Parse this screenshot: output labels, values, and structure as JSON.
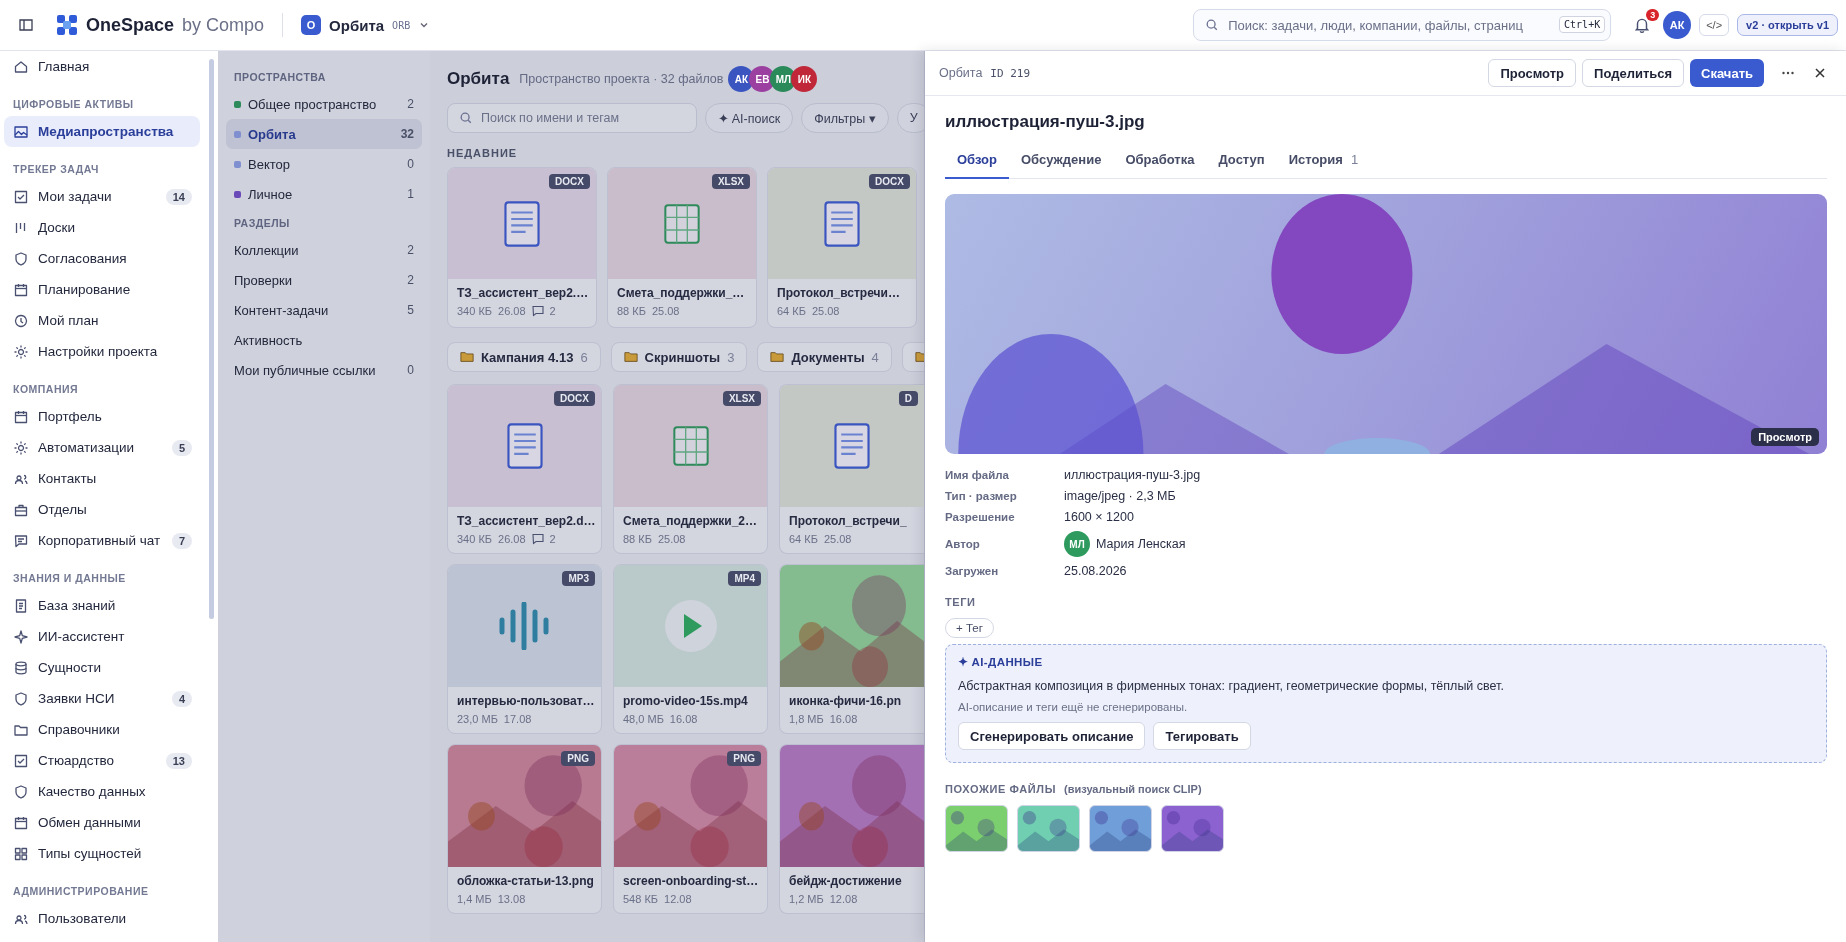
{
  "topbar": {
    "brand": "OneSpace",
    "brand_suffix": "by Compo",
    "workspace": {
      "initial": "O",
      "name": "Орбита",
      "code": "ORB"
    },
    "search": {
      "placeholder": "Поиск: задачи, люди, компании, файлы, страниц",
      "shortcut": "Ctrl+K"
    },
    "notifications": "3",
    "user_initials": "АК",
    "code_button": "</>",
    "version_button": "v2 · открыть v1"
  },
  "sidebar": {
    "groups": [
      {
        "items": [
          {
            "label": "Главная",
            "selected": false
          }
        ]
      },
      {
        "title": "ЦИФРОВЫЕ АКТИВЫ",
        "items": [
          {
            "label": "Медиапространства",
            "selected": true
          }
        ]
      },
      {
        "title": "ТРЕКЕР ЗАДАЧ",
        "items": [
          {
            "label": "Мои задачи",
            "count": "14",
            "selected": false
          },
          {
            "label": "Доски",
            "selected": false
          },
          {
            "label": "Согласования",
            "selected": false
          },
          {
            "label": "Планирование",
            "selected": false
          },
          {
            "label": "Мой план",
            "selected": false
          },
          {
            "label": "Настройки проекта",
            "selected": false
          }
        ]
      },
      {
        "title": "КОМПАНИЯ",
        "items": [
          {
            "label": "Портфель",
            "selected": false
          },
          {
            "label": "Автоматизации",
            "count": "5",
            "selected": false
          },
          {
            "label": "Контакты",
            "selected": false
          },
          {
            "label": "Отделы",
            "selected": false
          },
          {
            "label": "Корпоративный чат",
            "count": "7",
            "selected": false
          }
        ]
      },
      {
        "title": "ЗНАНИЯ И ДАННЫЕ",
        "items": [
          {
            "label": "База знаний",
            "selected": false
          },
          {
            "label": "ИИ-ассистент",
            "selected": false
          },
          {
            "label": "Сущности",
            "selected": false
          },
          {
            "label": "Заявки НСИ",
            "count": "4",
            "selected": false
          },
          {
            "label": "Справочники",
            "selected": false
          },
          {
            "label": "Стюардство",
            "count": "13",
            "selected": false
          },
          {
            "label": "Качество данных",
            "selected": false
          },
          {
            "label": "Обмен данными",
            "selected": false
          },
          {
            "label": "Типы сущностей",
            "selected": false
          }
        ]
      },
      {
        "title": "АДМИНИСТРИРОВАНИЕ",
        "items": [
          {
            "label": "Пользователи",
            "selected": false
          }
        ]
      }
    ]
  },
  "spaces": {
    "sections": [
      {
        "title": "ПРОСТРАНСТВА",
        "items": [
          {
            "label": "Общее пространство",
            "count": "2",
            "color": "#2e8a5a",
            "selected": false
          },
          {
            "label": "Орбита",
            "count": "32",
            "color": "#7f8fcf",
            "selected": true
          },
          {
            "label": "Вектор",
            "count": "0",
            "color": "#7f8fcf",
            "selected": false
          },
          {
            "label": "Личное",
            "count": "1",
            "color": "#6a4ab8",
            "selected": false
          }
        ]
      },
      {
        "title": "РАЗДЕЛЫ",
        "items": [
          {
            "label": "Коллекции",
            "count": "2",
            "selected": false
          },
          {
            "label": "Проверки",
            "count": "2",
            "selected": false
          },
          {
            "label": "Контент-задачи",
            "count": "5",
            "selected": false
          },
          {
            "label": "Активность",
            "selected": false
          },
          {
            "label": "Мои публичные ссылки",
            "count": "0",
            "selected": false
          }
        ]
      }
    ]
  },
  "main": {
    "title": "Орбита",
    "subtitle": "Пространство проекта · 32 файлов",
    "members": [
      {
        "initials": "АК",
        "color": "#3a55c0"
      },
      {
        "initials": "ЕВ",
        "color": "#9b3fa0"
      },
      {
        "initials": "МЛ",
        "color": "#2a8a5a"
      },
      {
        "initials": "ИК",
        "color": "#c0283a"
      }
    ],
    "search": {
      "placeholder": "Поиск по имени и тегам"
    },
    "filters": [
      "✦ AI-поиск",
      "Фильтры ▾",
      "У"
    ],
    "recent_title": "НЕДАВНИЕ",
    "recent": [
      {
        "name": "ТЗ_ассистент_вер2.…",
        "kind": "doc",
        "badge": "DOCX",
        "color": "#c9bfd3",
        "size": "340 КБ",
        "date": "26.08",
        "comments": "2"
      },
      {
        "name": "Смета_поддержки_…",
        "kind": "sheet",
        "badge": "XLSX",
        "color": "#c9bdcb",
        "size": "88 КБ",
        "date": "25.08"
      },
      {
        "name": "Протокол_встречи…",
        "kind": "doc",
        "badge": "DOCX",
        "color": "#c3c8c4",
        "size": "64 КБ",
        "date": "25.08"
      }
    ],
    "folders": [
      {
        "name": "Кампания 4.13",
        "count": "6"
      },
      {
        "name": "Скриншоты",
        "count": "3"
      },
      {
        "name": "Документы",
        "count": "4"
      }
    ],
    "folder_overflow": true,
    "files": [
      {
        "name": "ТЗ_ассистент_вер2.d…",
        "kind": "doc",
        "badge": "DOCX",
        "color": "#c9bfd3",
        "size": "340 КБ",
        "date": "26.08",
        "comments": "2"
      },
      {
        "name": "Смета_поддержки_2…",
        "kind": "sheet",
        "badge": "XLSX",
        "color": "#c9bdcb",
        "size": "88 КБ",
        "date": "25.08"
      },
      {
        "name": "Протокол_встречи_",
        "kind": "doc",
        "badge": "D",
        "color": "#c3c8c4",
        "size": "64 КБ",
        "date": "25.08"
      },
      {
        "name": "интервью-пользоват…",
        "kind": "audio",
        "badge": "MP3",
        "color": "#bcc4d4",
        "size": "23,0 МБ",
        "date": "17.08"
      },
      {
        "name": "promo-video-15s.mp4",
        "kind": "video",
        "badge": "MP4",
        "color": "#bac9c9",
        "size": "48,0 МБ",
        "date": "16.08"
      },
      {
        "name": "иконка-фичи-16.pn",
        "kind": "image",
        "color": "#84bb8f",
        "size": "1,8 МБ",
        "date": "16.08"
      },
      {
        "name": "обложка-статьи-13.png",
        "kind": "image",
        "badge": "PNG",
        "color": "#b77a90",
        "size": "1,4 МБ",
        "date": "13.08"
      },
      {
        "name": "screen-onboarding-st…",
        "kind": "image",
        "badge": "PNG",
        "color": "#bb7e9a",
        "size": "548 КБ",
        "date": "12.08"
      },
      {
        "name": "бейдж-достижение",
        "kind": "image",
        "color": "#a470b4",
        "size": "1,2 МБ",
        "date": "12.08"
      }
    ]
  },
  "drawer": {
    "space": "Орбита",
    "id": "ID 219",
    "actions": [
      {
        "label": "Просмотр",
        "kind": "secondary"
      },
      {
        "label": "Поделиться",
        "kind": "secondary"
      },
      {
        "label": "Скачать",
        "kind": "primary"
      }
    ],
    "title": "иллюстрация-пуш-3.jpg",
    "tabs": [
      {
        "label": "Обзор",
        "selected": true
      },
      {
        "label": "Обсуждение",
        "selected": false
      },
      {
        "label": "Обработка",
        "selected": false
      },
      {
        "label": "Доступ",
        "selected": false
      },
      {
        "label": "История",
        "count": "1",
        "selected": false
      }
    ],
    "preview_badge": "Просмотр",
    "meta": [
      {
        "label": "Имя файла",
        "kind": "text",
        "value": "иллюстрация-пуш-3.jpg"
      },
      {
        "label": "Тип · размер",
        "kind": "text",
        "value": "image/jpeg · 2,3 МБ"
      },
      {
        "label": "Разрешение",
        "kind": "text",
        "value": "1600 × 1200"
      },
      {
        "label": "Автор",
        "kind": "person",
        "initials": "МЛ",
        "color": "#2e9a5e",
        "value": "Мария Ленская"
      },
      {
        "label": "Загружен",
        "kind": "text",
        "value": "25.08.2026"
      }
    ],
    "tags": {
      "title": "ТЕГИ",
      "add": "+ Тег"
    },
    "ai": {
      "title": "✦ AI-ДАННЫЕ",
      "description": "Абстрактная композиция в фирменных тонах: градиент, геометрические формы, тёплый свет.",
      "hint": "AI-описание и теги ещё не сгенерированы.",
      "buttons": [
        "Сгенерировать описание",
        "Тегировать"
      ]
    },
    "similar": {
      "title": "ПОХОЖИЕ ФАЙЛЫ",
      "subtitle": "(визуальный поиск CLIP)",
      "items": [
        {
          "color": "#7ccf6e"
        },
        {
          "color": "#6fcfb0"
        },
        {
          "color": "#6f9ed8"
        },
        {
          "color": "#8c62d0"
        }
      ]
    }
  }
}
